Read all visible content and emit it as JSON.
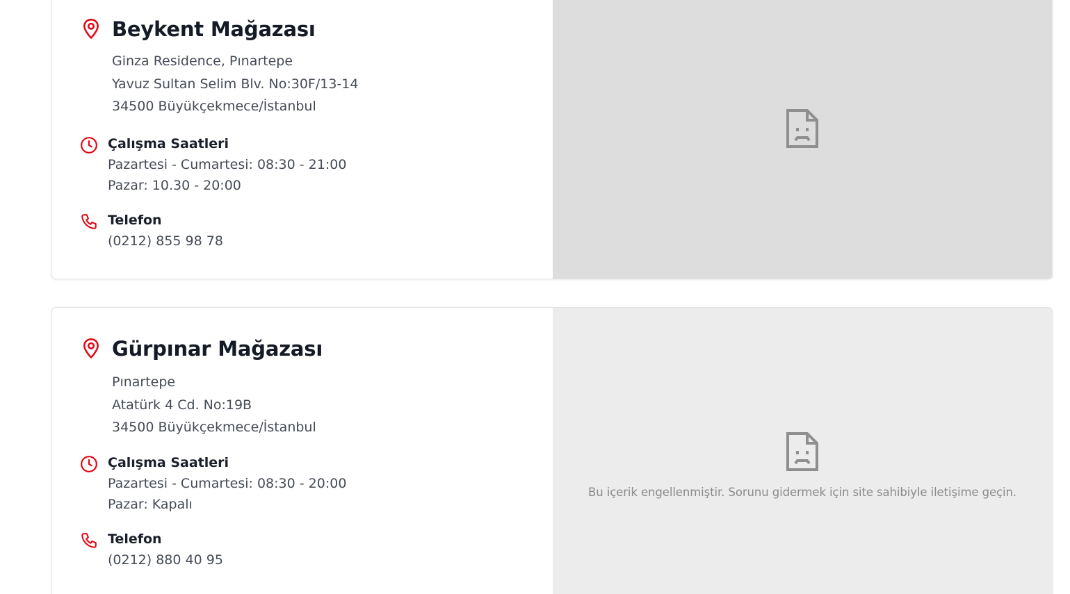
{
  "colors": {
    "accent": "#e30613",
    "title": "#141a26",
    "body_text": "#454b57",
    "map_blocked_bg_1": "#dddddd",
    "map_blocked_bg_2": "#ececec",
    "map_icon": "#8f8f8f"
  },
  "stores": [
    {
      "name": "Beykent Mağazası",
      "address": [
        "Ginza Residence, Pınartepe",
        "Yavuz Sultan Selim Blv. No:30F/13-14",
        "34500 Büyükçekmece/İstanbul"
      ],
      "hours_heading": "Çalışma Saatleri",
      "hours": [
        "Pazartesi - Cumartesi: 08:30 - 21:00",
        "Pazar: 10.30 - 20:00"
      ],
      "phone_heading": "Telefon",
      "phone": "(0212) 855 98 78",
      "map": {
        "icon": "sad-document-icon",
        "message": ""
      }
    },
    {
      "name": "Gürpınar Mağazası",
      "address": [
        "Pınartepe",
        "Atatürk 4 Cd. No:19B",
        "34500 Büyükçekmece/İstanbul"
      ],
      "hours_heading": "Çalışma Saatleri",
      "hours": [
        "Pazartesi - Cumartesi: 08:30 - 20:00",
        "Pazar: Kapalı"
      ],
      "phone_heading": "Telefon",
      "phone": "(0212) 880 40 95",
      "map": {
        "icon": "sad-document-icon",
        "message": "Bu içerik engellenmiştir. Sorunu gidermek için site sahibiyle iletişime geçin."
      }
    }
  ]
}
